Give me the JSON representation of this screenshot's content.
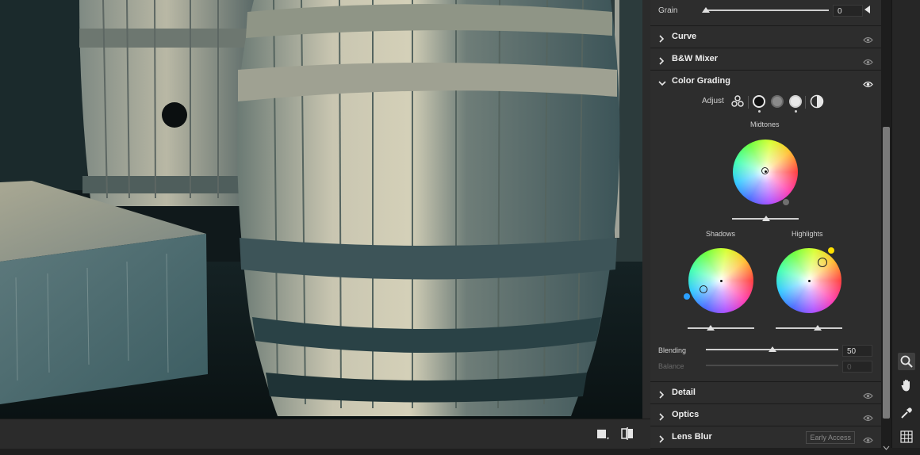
{
  "panel": {
    "grain": {
      "label": "Grain",
      "value": "0"
    },
    "sections": [
      {
        "title": "Curve",
        "expanded": false
      },
      {
        "title": "B&W Mixer",
        "expanded": false
      },
      {
        "title": "Color Grading",
        "expanded": true
      },
      {
        "title": "Detail",
        "expanded": false
      },
      {
        "title": "Optics",
        "expanded": false
      },
      {
        "title": "Lens Blur",
        "expanded": false,
        "badge": "Early Access"
      }
    ],
    "color_grading": {
      "adjust_label": "Adjust",
      "midtones_label": "Midtones",
      "shadows_label": "Shadows",
      "highlights_label": "Highlights",
      "blending": {
        "label": "Blending",
        "value": "50"
      },
      "balance": {
        "label": "Balance",
        "value": "0"
      }
    }
  },
  "toolbar": {
    "tools": [
      "search-icon",
      "hand-icon",
      "eyedropper-icon",
      "grid-icon"
    ]
  },
  "colors": {
    "panel_bg": "#2d2d2d",
    "shadow_dot": "#2aa0ff",
    "highlight_dot": "#ffe000",
    "midtone_dot": "#6f6f6f"
  }
}
